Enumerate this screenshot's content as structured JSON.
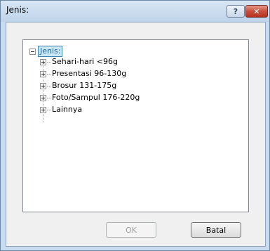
{
  "window": {
    "title": "Jenis:"
  },
  "titlebar_buttons": {
    "help_icon": "?",
    "close_icon": "✕"
  },
  "tree": {
    "root": {
      "label": "Jenis:",
      "expanded": true
    },
    "children": [
      {
        "label": "Sehari-hari <96g"
      },
      {
        "label": "Presentasi 96-130g"
      },
      {
        "label": "Brosur 131-175g"
      },
      {
        "label": "Foto/Sampul 176-220g"
      },
      {
        "label": "Lainnya"
      }
    ]
  },
  "buttons": {
    "ok_label": "OK",
    "cancel_label": "Batal"
  },
  "colors": {
    "selection_bg": "#cbe8f6",
    "selection_border": "#3c7fb1",
    "close_red": "#c84f3c"
  }
}
